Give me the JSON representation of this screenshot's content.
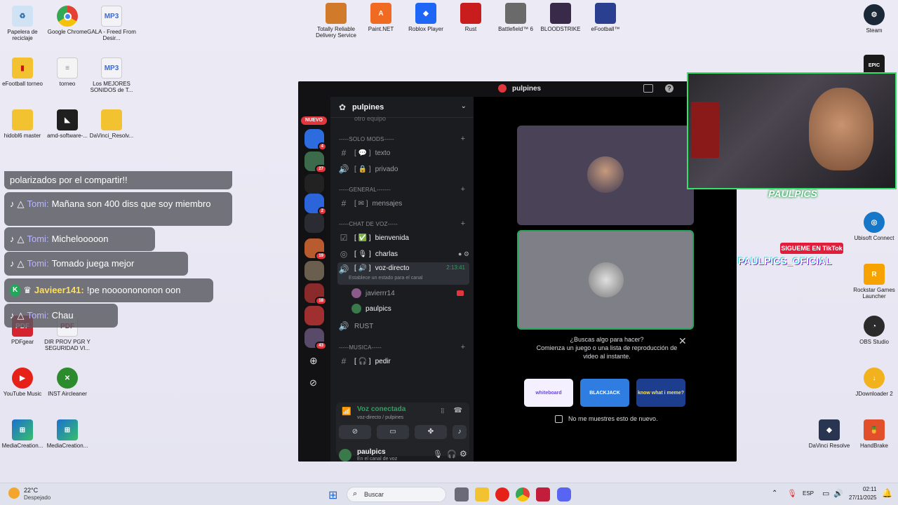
{
  "desktop_icons_left": [
    {
      "label": "Papelera de reciclaje",
      "icon": "recycle-bin-icon",
      "color": "#5ba3d9"
    },
    {
      "label": "Google Chrome",
      "icon": "chrome-icon",
      "color": "#e34133"
    },
    {
      "label": "GALA - Freed From Desir...",
      "icon": "mp3-file-icon",
      "color": "#e9e9ef"
    },
    {
      "label": "eFootball torneo",
      "icon": "folder-icon",
      "color": "#f2c230"
    },
    {
      "label": "torneo",
      "icon": "text-file-icon",
      "color": "#f4f4f4"
    },
    {
      "label": "Los MEJORES SONIDOS de T...",
      "icon": "mp3-file-icon",
      "color": "#e9e9ef"
    },
    {
      "label": "hidobl6 master",
      "icon": "folder-icon",
      "color": "#f2c230"
    },
    {
      "label": "amd-software-...",
      "icon": "amd-installer-icon",
      "color": "#262626"
    },
    {
      "label": "DaVinci_Resolv...",
      "icon": "folder-icon",
      "color": "#f2c230"
    },
    {
      "label": "PDFgear",
      "icon": "pdfgear-icon",
      "color": "#d3242f"
    },
    {
      "label": "DIR PROV PGR Y SEGURIDAD VI...",
      "icon": "pdf-file-icon",
      "color": "#d3242f"
    },
    {
      "label": "YouTube Music",
      "icon": "youtube-music-icon",
      "color": "#e62117"
    },
    {
      "label": "INST Aircleaner",
      "icon": "xbox-icon",
      "color": "#2c8b2c"
    },
    {
      "label": "MediaCreation...",
      "icon": "media-creation-icon",
      "color": "#1d6fd1"
    },
    {
      "label": "MediaCreation...",
      "icon": "media-creation-icon",
      "color": "#1d6fd1"
    }
  ],
  "desktop_icons_top": [
    {
      "label": "Totally Reliable Delivery Service",
      "color": "#d07a2a"
    },
    {
      "label": "Paint.NET",
      "color": "#f06a22"
    },
    {
      "label": "Roblox Player",
      "color": "#1e66f5"
    },
    {
      "label": "Rust",
      "color": "#c91c1c"
    },
    {
      "label": "Battlefield™ 6",
      "color": "#6a6a6a"
    },
    {
      "label": "BLOODSTRIKE",
      "color": "#3a2a4a"
    },
    {
      "label": "eFootball™",
      "color": "#2a3f8f"
    }
  ],
  "desktop_icons_right": [
    {
      "label": "Steam",
      "color": "#1b2838"
    },
    {
      "label": "Epic Games",
      "color": "#1a1a1a"
    },
    {
      "label": "Ubisoft Connect",
      "color": "#1677c9"
    },
    {
      "label": "Rockstar Games Launcher",
      "color": "#f6a200"
    },
    {
      "label": "OBS Studio",
      "color": "#2b2b2b"
    },
    {
      "label": "JDownloader 2",
      "color": "#f2b21e"
    },
    {
      "label": "DaVinci Resolve",
      "color": "#2a3552"
    },
    {
      "label": "HandBrake",
      "color": "#e1502a"
    }
  ],
  "chat_overlay": [
    {
      "name": "",
      "text": "polarizados por el compartir!!"
    },
    {
      "name": "Tomi:",
      "text": "Mañana son 400 diss que soy miembro"
    },
    {
      "name": "Tomi:",
      "text": "Michelooooon"
    },
    {
      "name": "Tomi:",
      "text": "Tomado juega mejor"
    },
    {
      "name": "Javieer141:",
      "text": "!pe noooonononon oon"
    },
    {
      "name": "Tomi:",
      "text": "Chau"
    }
  ],
  "discord": {
    "window_title": "pulpines",
    "server_name": "pulpines",
    "nuevo_badge": "NUEVO",
    "partial_top_row": "otro equipo",
    "categories": {
      "solo_mods": "-----SOLO MODS-----",
      "general": "-----GENERAL-------",
      "chat_de_voz": "-----CHAT DE VOZ-----",
      "musica": "-----MUSICA-----"
    },
    "channels": {
      "texto": "texto",
      "privado": "privado",
      "mensajes": "mensajes",
      "bienvenida": "bienvenida",
      "charlas": "charlas",
      "voz_directo": "voz-directo",
      "voz_timer": "2:13:41",
      "voz_status": "Establece un estado para el canal",
      "user1": "javierrr14",
      "user2": "paulpics",
      "rust": "RUST",
      "pedir": "pedir"
    },
    "voice_panel": {
      "status": "Voz conectada",
      "location": "voz-directo / pulpines"
    },
    "user_panel": {
      "username": "paulpics",
      "status": "En el canal de voz"
    },
    "server_badges": [
      "4",
      "27",
      "2",
      "19",
      "18",
      "43"
    ],
    "popup": {
      "title": "¿Buscas algo para hacer?",
      "body": "Comienza un juego o una lista de reproducción de video al instante.",
      "checkbox_label": "No me muestres esto de nuevo.",
      "activities": [
        "whiteboard",
        "BLACKJACK",
        "know what i meme?"
      ]
    }
  },
  "webcam_overlay": {
    "brand": "PAULPICS",
    "tiktok_banner": "SIGUEME EN TikTok",
    "tiktok_handle": "PAULPICS_OFICIAL"
  },
  "taskbar": {
    "weather_temp": "22°C",
    "weather_desc": "Despejado",
    "search_placeholder": "Buscar",
    "lang": "ESP",
    "time": "02:11",
    "date": "27/11/2025"
  },
  "colors": {
    "discord_bg": "#1b1c20",
    "discord_sidebar": "#121214",
    "accent_green": "#23a55a",
    "badge_red": "#e0363c",
    "cam_border": "#34e26a"
  }
}
